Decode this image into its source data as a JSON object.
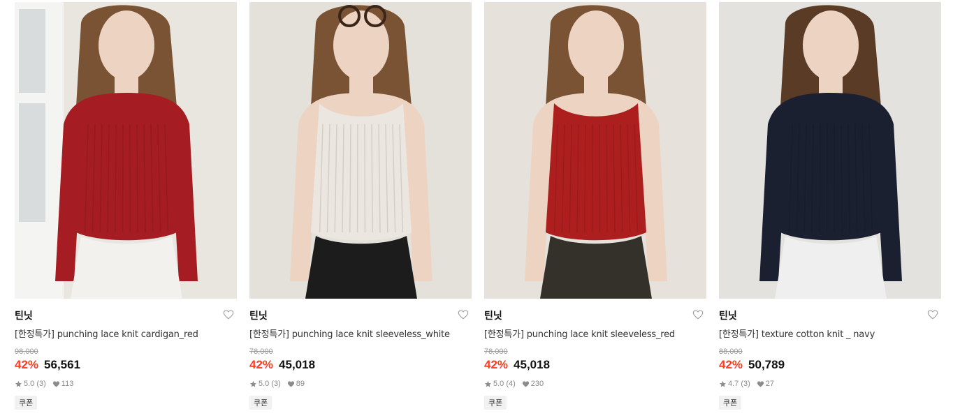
{
  "products": [
    {
      "brand": "틴닛",
      "name": "[한정특가] punching lace knit cardigan_red",
      "original_price": "98,000",
      "discount": "42%",
      "price": "56,561",
      "rating": "5.0 (3)",
      "likes": "113",
      "badge": "쿠폰",
      "garment_color": "#a51d22",
      "bottom_color": "#f2f1ee",
      "bg_color": "#e9e6e0"
    },
    {
      "brand": "틴닛",
      "name": "[한정특가] punching lace knit sleeveless_white",
      "original_price": "78,000",
      "discount": "42%",
      "price": "45,018",
      "rating": "5.0 (3)",
      "likes": "89",
      "badge": "쿠폰",
      "garment_color": "#ece6e0",
      "bottom_color": "#1c1c1c",
      "bg_color": "#e4e0da"
    },
    {
      "brand": "틴닛",
      "name": "[한정특가] punching lace knit sleeveless_red",
      "original_price": "78,000",
      "discount": "42%",
      "price": "45,018",
      "rating": "5.0 (4)",
      "likes": "230",
      "badge": "쿠폰",
      "garment_color": "#ad1f1f",
      "bottom_color": "#34302a",
      "bg_color": "#e6e1da"
    },
    {
      "brand": "틴닛",
      "name": "[한정특가] texture cotton knit _ navy",
      "original_price": "88,000",
      "discount": "42%",
      "price": "50,789",
      "rating": "4.7 (3)",
      "likes": "27",
      "badge": "쿠폰",
      "garment_color": "#1b2030",
      "bottom_color": "#efefef",
      "bg_color": "#e3e2df"
    }
  ]
}
